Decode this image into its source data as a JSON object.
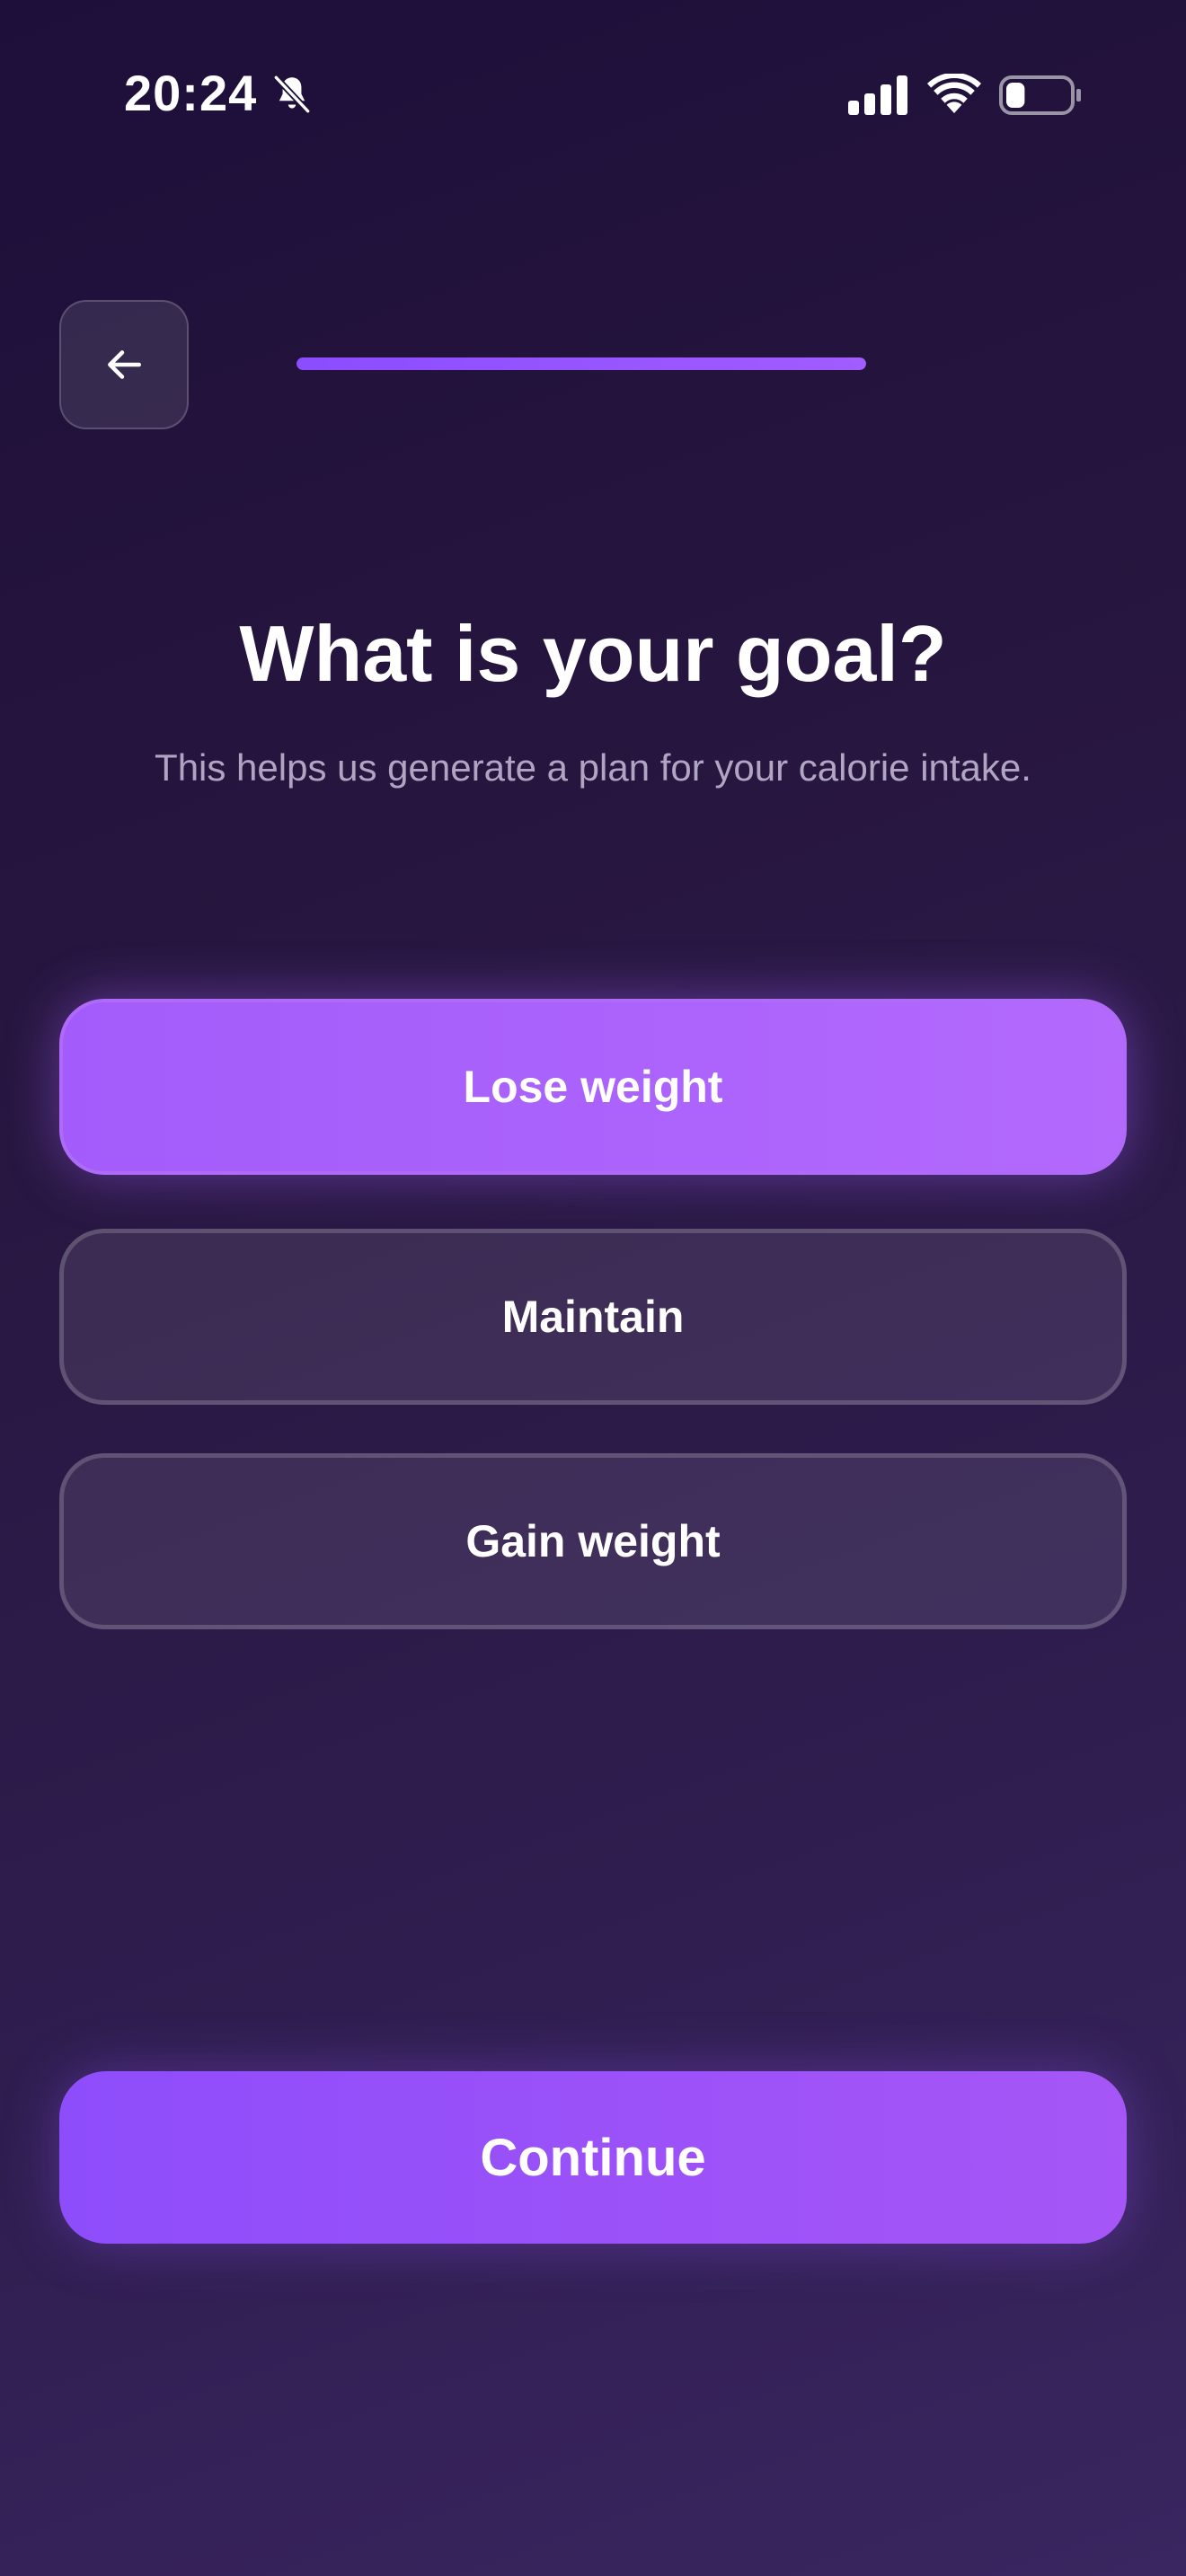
{
  "status_bar": {
    "time": "20:24",
    "icons": [
      "bell-slash-icon",
      "cellular-signal-icon",
      "wifi-icon",
      "battery-icon"
    ],
    "battery_level": 0.3
  },
  "header": {
    "back_icon": "arrow-left-icon",
    "progress": 1.0
  },
  "main": {
    "title": "What is your goal?",
    "subtitle": "This helps us generate a plan for your calorie intake.",
    "options": [
      {
        "label": "Lose weight",
        "selected": true
      },
      {
        "label": "Maintain",
        "selected": false
      },
      {
        "label": "Gain weight",
        "selected": false
      }
    ]
  },
  "footer": {
    "continue_label": "Continue"
  },
  "colors": {
    "accent": "#a35cfb",
    "accent_dark": "#8e4dfb",
    "background_top": "#1d0f3a",
    "background_bottom": "#3a2660"
  }
}
